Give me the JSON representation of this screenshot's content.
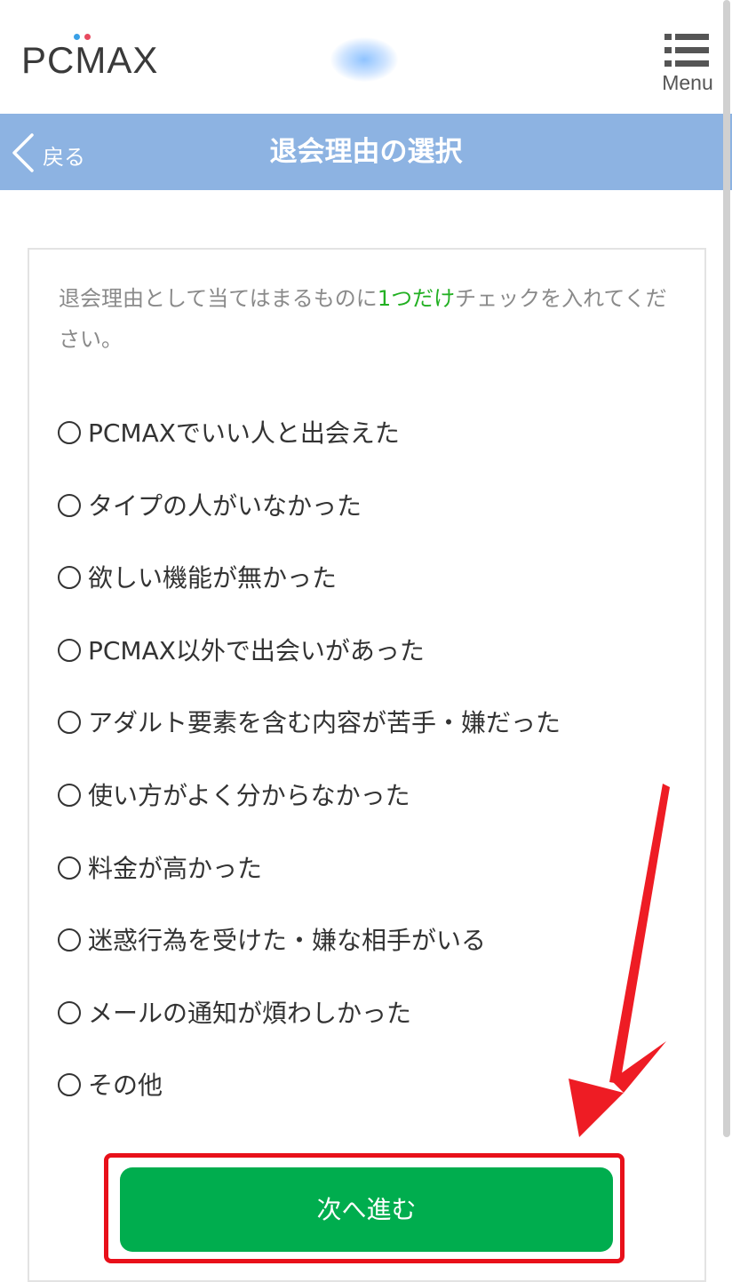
{
  "header": {
    "logo": "PCMAX",
    "menu_label": "Menu"
  },
  "titlebar": {
    "back_label": "戻る",
    "title": "退会理由の選択"
  },
  "instruction": {
    "before": "退会理由として当てはまるものに",
    "emphasis": "1つだけ",
    "after": "チェックを入れてください。"
  },
  "options": [
    {
      "label": "PCMAXでいい人と出会えた",
      "selected": false
    },
    {
      "label": "タイプの人がいなかった",
      "selected": false
    },
    {
      "label": "欲しい機能が無かった",
      "selected": false
    },
    {
      "label": "PCMAX以外で出会いがあった",
      "selected": false
    },
    {
      "label": "アダルト要素を含む内容が苦手・嫌だった",
      "selected": false
    },
    {
      "label": "使い方がよく分からなかった",
      "selected": false
    },
    {
      "label": "料金が高かった",
      "selected": false
    },
    {
      "label": "迷惑行為を受けた・嫌な相手がいる",
      "selected": false
    },
    {
      "label": "メールの通知が煩わしかった",
      "selected": false
    },
    {
      "label": "その他",
      "selected": false
    }
  ],
  "next_button": {
    "label": "次へ進む"
  },
  "colors": {
    "titlebar": "#8db3e2",
    "next_button": "#00ad4e",
    "emphasis": "#22b022",
    "annotation": "#e8101a"
  }
}
